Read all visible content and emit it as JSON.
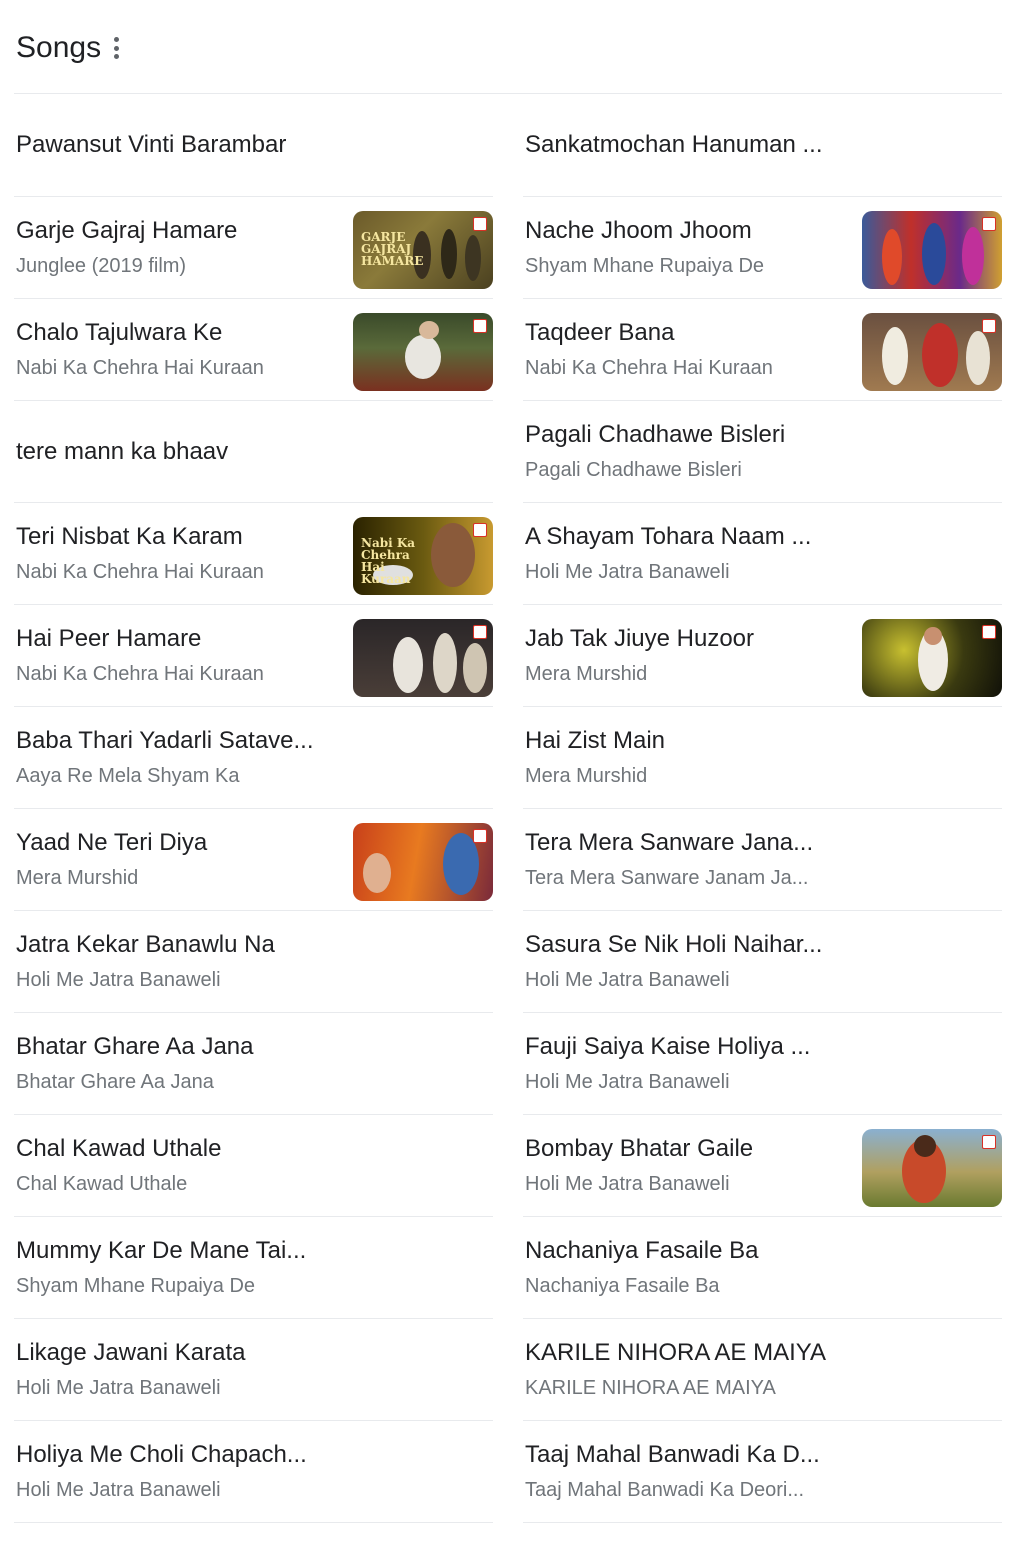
{
  "section": {
    "title": "Songs",
    "menu_icon": "more-vert-icon"
  },
  "left": [
    {
      "song": "Pawansut Vinti Barambar",
      "album": ""
    },
    {
      "song": "Garje Gajraj Hamare",
      "album": "Junglee (2019 film)",
      "thumb": "garje-gajraj-hamare-thumbnail",
      "thumb_text": "GARJE GAJRAJ HAMARE"
    },
    {
      "song": "Chalo Tajulwara Ke",
      "album": "Nabi Ka Chehra Hai Kuraan",
      "thumb": "chalo-tajulwara-ke-thumbnail"
    },
    {
      "song": "tere mann ka bhaav",
      "album": ""
    },
    {
      "song": "Teri Nisbat Ka Karam",
      "album": "Nabi Ka Chehra Hai Kuraan",
      "thumb": "teri-nisbat-ka-karam-thumbnail",
      "thumb_text": "Nabi Ka Chehra Hai Kuraan"
    },
    {
      "song": "Hai Peer Hamare",
      "album": "Nabi Ka Chehra Hai Kuraan",
      "thumb": "hai-peer-hamare-thumbnail"
    },
    {
      "song": "Baba Thari Yadarli Satave...",
      "album": "Aaya Re Mela Shyam Ka"
    },
    {
      "song": "Yaad Ne Teri Diya",
      "album": "Mera Murshid",
      "thumb": "yaad-ne-teri-diya-thumbnail"
    },
    {
      "song": "Jatra Kekar Banawlu Na",
      "album": "Holi Me Jatra Banaweli"
    },
    {
      "song": "Bhatar Ghare Aa Jana",
      "album": "Bhatar Ghare Aa Jana"
    },
    {
      "song": "Chal Kawad Uthale",
      "album": "Chal Kawad Uthale"
    },
    {
      "song": "Mummy Kar De Mane Tai...",
      "album": "Shyam Mhane Rupaiya De"
    },
    {
      "song": "Likage Jawani Karata",
      "album": "Holi Me Jatra Banaweli"
    },
    {
      "song": "Holiya Me Choli Chapach...",
      "album": "Holi Me Jatra Banaweli"
    }
  ],
  "right": [
    {
      "song": "Sankatmochan Hanuman ...",
      "album": ""
    },
    {
      "song": "Nache Jhoom Jhoom",
      "album": "Shyam Mhane Rupaiya De",
      "thumb": "nache-jhoom-jhoom-thumbnail"
    },
    {
      "song": "Taqdeer Bana",
      "album": "Nabi Ka Chehra Hai Kuraan",
      "thumb": "taqdeer-bana-thumbnail"
    },
    {
      "song": "Pagali Chadhawe Bisleri",
      "album": "Pagali Chadhawe Bisleri"
    },
    {
      "song": "A Shayam Tohara Naam ...",
      "album": "Holi Me Jatra Banaweli"
    },
    {
      "song": "Jab Tak Jiuye Huzoor",
      "album": "Mera Murshid",
      "thumb": "jab-tak-jiuye-huzoor-thumbnail"
    },
    {
      "song": "Hai Zist Main",
      "album": "Mera Murshid"
    },
    {
      "song": "Tera Mera Sanware Jana...",
      "album": "Tera Mera Sanware Janam Ja..."
    },
    {
      "song": "Sasura Se Nik Holi Naihar...",
      "album": "Holi Me Jatra Banaweli"
    },
    {
      "song": "Fauji Saiya Kaise Holiya ...",
      "album": "Holi Me Jatra Banaweli"
    },
    {
      "song": "Bombay Bhatar Gaile",
      "album": "Holi Me Jatra Banaweli",
      "thumb": "bombay-bhatar-gaile-thumbnail"
    },
    {
      "song": "Nachaniya Fasaile Ba",
      "album": "Nachaniya Fasaile Ba"
    },
    {
      "song": "KARILE NIHORA AE MAIYA",
      "album": "KARILE NIHORA AE MAIYA"
    },
    {
      "song": "Taaj Mahal Banwadi Ka D...",
      "album": "Taaj Mahal Banwadi Ka Deori..."
    }
  ]
}
